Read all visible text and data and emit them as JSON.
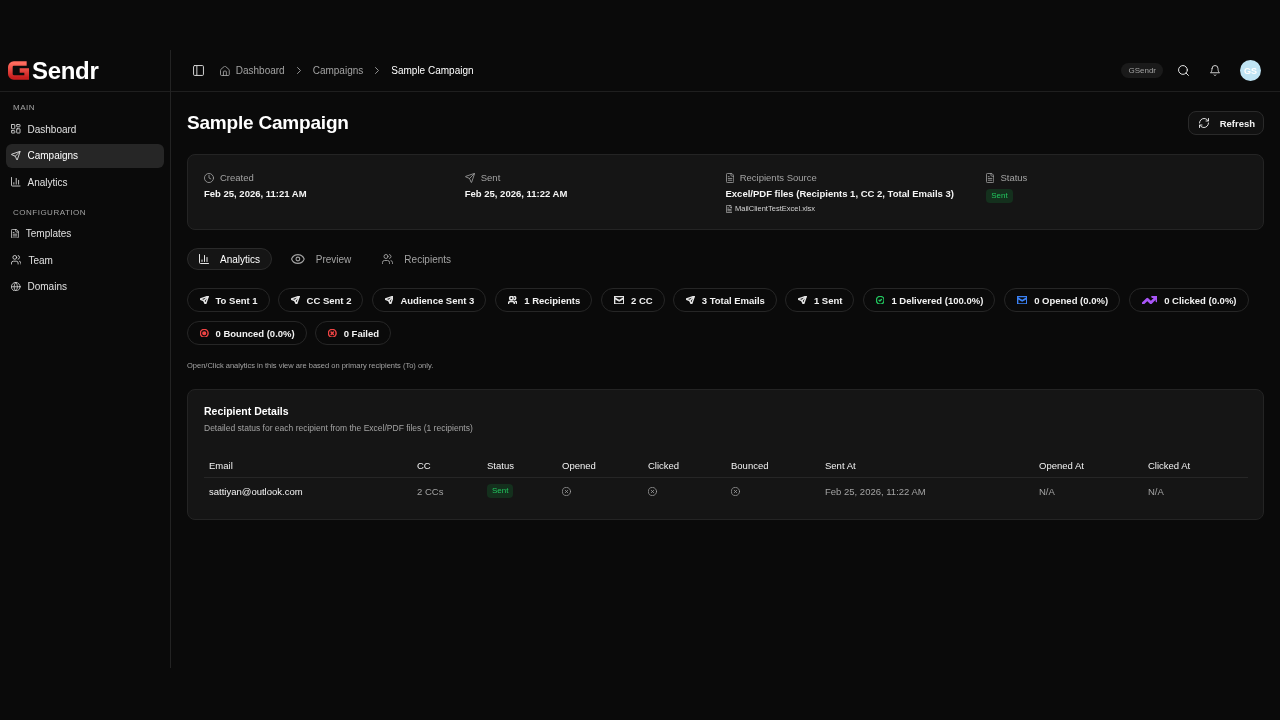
{
  "brand": {
    "name": "Sendr"
  },
  "sidebar": {
    "sections": [
      {
        "heading": "MAIN",
        "items": [
          {
            "label": "Dashboard",
            "selected": false
          },
          {
            "label": "Campaigns",
            "selected": true
          },
          {
            "label": "Analytics",
            "selected": false
          }
        ]
      },
      {
        "heading": "CONFIGURATION",
        "items": [
          {
            "label": "Templates",
            "selected": false
          },
          {
            "label": "Team",
            "selected": false
          },
          {
            "label": "Domains",
            "selected": false
          }
        ]
      }
    ]
  },
  "header": {
    "breadcrumbs": [
      {
        "label": "Dashboard",
        "current": false
      },
      {
        "label": "Campaigns",
        "current": false
      },
      {
        "label": "Sample Campaign",
        "current": true
      }
    ],
    "workspace": "GSendr",
    "avatar": "GS"
  },
  "page": {
    "title": "Sample Campaign",
    "refresh_button": "Refresh"
  },
  "summary": [
    {
      "label": "Created",
      "value": "Feb 25, 2026, 11:21 AM"
    },
    {
      "label": "Sent",
      "value": "Feb 25, 2026, 11:22 AM"
    },
    {
      "label": "Recipients Source",
      "value": "Excel/PDF files (Recipients 1, CC 2, Total Emails 3)",
      "file": "MailClientTestExcel.xlsx"
    },
    {
      "label": "Status",
      "badge": "Sent"
    }
  ],
  "tabs": [
    {
      "label": "Analytics",
      "selected": true
    },
    {
      "label": "Preview",
      "selected": false
    },
    {
      "label": "Recipients",
      "selected": false
    }
  ],
  "stats": [
    {
      "label": "To Sent 1",
      "kind": "send",
      "color": "#e5e5e5"
    },
    {
      "label": "CC Sent 2",
      "kind": "send",
      "color": "#e5e5e5"
    },
    {
      "label": "Audience Sent 3",
      "kind": "send",
      "color": "#e5e5e5"
    },
    {
      "label": "1 Recipients",
      "kind": "users",
      "color": "#e5e5e5"
    },
    {
      "label": "2 CC",
      "kind": "mail",
      "color": "#e5e5e5"
    },
    {
      "label": "3 Total Emails",
      "kind": "send",
      "color": "#e5e5e5"
    },
    {
      "label": "1 Sent",
      "kind": "send",
      "color": "#e5e5e5"
    },
    {
      "label": "1 Delivered (100.0%)",
      "kind": "check",
      "color": "#22c55e"
    },
    {
      "label": "0 Opened (0.0%)",
      "kind": "mail",
      "color": "#3b82f6"
    },
    {
      "label": "0 Clicked (0.0%)",
      "kind": "trend",
      "color": "#a855f7"
    },
    {
      "label": "0 Bounced (0.0%)",
      "kind": "target",
      "color": "#ef4444"
    },
    {
      "label": "0 Failed",
      "kind": "cross",
      "color": "#ef4444"
    }
  ],
  "note": "Open/Click analytics in this view are based on primary recipients (To) only.",
  "recipient_details": {
    "title": "Recipient Details",
    "subtitle": "Detailed status for each recipient from the Excel/PDF files (1 recipients)",
    "columns": [
      "Email",
      "CC",
      "Status",
      "Opened",
      "Clicked",
      "Bounced",
      "Sent At",
      "Opened At",
      "Clicked At"
    ],
    "rows": [
      {
        "email": "sattiyan@outlook.com",
        "cc": "2 CCs",
        "status": "Sent",
        "opened": false,
        "clicked": false,
        "bounced": false,
        "sent_at": "Feb 25, 2026, 11:22 AM",
        "opened_at": "N/A",
        "clicked_at": "N/A"
      }
    ]
  }
}
